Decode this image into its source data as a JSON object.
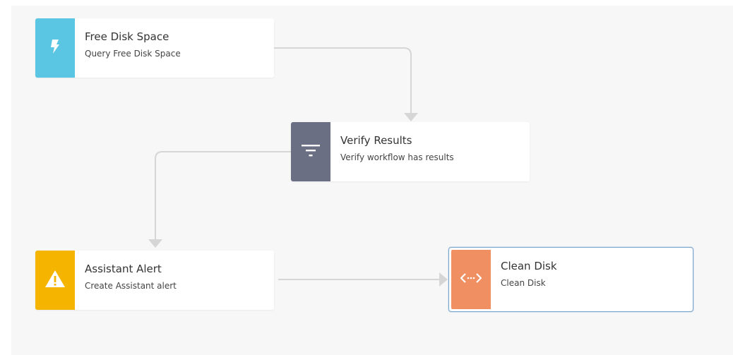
{
  "nodes": [
    {
      "id": "free-disk-space",
      "title": "Free Disk Space",
      "subtitle": "Query Free Disk Space",
      "icon": "lightning-bolt-icon",
      "color": "#5bc5e4"
    },
    {
      "id": "verify-results",
      "title": "Verify Results",
      "subtitle": "Verify workflow has results",
      "icon": "filter-icon",
      "color": "#6b6f83"
    },
    {
      "id": "assistant-alert",
      "title": "Assistant Alert",
      "subtitle": "Create Assistant alert",
      "icon": "warning-icon",
      "color": "#f5b400"
    },
    {
      "id": "clean-disk",
      "title": "Clean Disk",
      "subtitle": "Clean Disk",
      "icon": "code-brackets-icon",
      "color": "#f09062",
      "selected": true
    }
  ],
  "edges": [
    {
      "from": "free-disk-space",
      "to": "verify-results"
    },
    {
      "from": "verify-results",
      "to": "assistant-alert"
    },
    {
      "from": "assistant-alert",
      "to": "clean-disk"
    }
  ],
  "colors": {
    "canvas_background": "#f7f7f7",
    "connector": "#d6d6d6",
    "selected_border": "#7ba7cf"
  }
}
